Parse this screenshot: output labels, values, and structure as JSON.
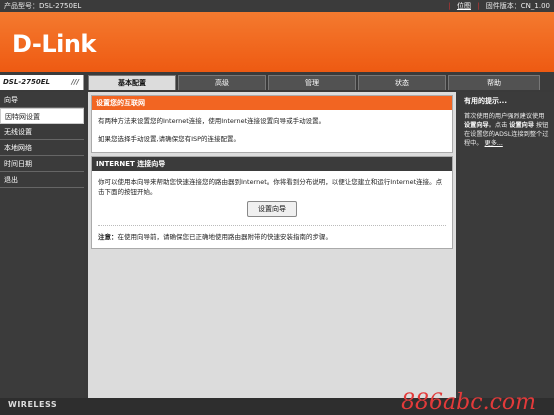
{
  "topbar": {
    "model": "产品型号：DSL-2750EL",
    "location": "位图",
    "firmware": "固件版本：CN_1.00"
  },
  "brand": {
    "logo": "D-Link"
  },
  "model_tab": {
    "label": "DSL-2750EL",
    "slashes": "///"
  },
  "tabs": [
    {
      "label": "基本配置",
      "active": true
    },
    {
      "label": "高级",
      "active": false
    },
    {
      "label": "管理",
      "active": false
    },
    {
      "label": "状态",
      "active": false
    },
    {
      "label": "帮助",
      "active": false
    }
  ],
  "sidebar": {
    "items": [
      {
        "label": "向导"
      },
      {
        "label": "因特网设置"
      },
      {
        "label": "无线设置"
      },
      {
        "label": "本地网络"
      },
      {
        "label": "时间日期"
      },
      {
        "label": "退出"
      }
    ]
  },
  "panel1": {
    "title": "设置您的互联网",
    "p1": "有两种方法来设置您的Internet连接，使用Internet连接设置向导或手动设置。",
    "p2": "如果您选择手动设置,请确保您有ISP的连接配置。"
  },
  "panel2": {
    "title": "INTERNET 连接向导",
    "desc": "你可以使用本向导来帮助您快速连接您的路由器到Internet。你将看到分布说明，以便让您建立和运行Internet连接。点击下面的按钮开始。",
    "button": "设置向导",
    "note_label": "注意：",
    "note": "在使用向导前，请确保您已正确地使用路由器附带的快速安装指南的步骤。"
  },
  "help": {
    "title": "有用的提示...",
    "text1": "首次使用的用户强烈建议使用",
    "bold1": "设置向导",
    "text2": "。点击",
    "bold2": "设置向导",
    "text3": "按钮在设置您的ADSL连接到整个过程中。",
    "more": "更多..."
  },
  "footer": {
    "left": "WIRELESS",
    "watermark": "886abc.com"
  }
}
